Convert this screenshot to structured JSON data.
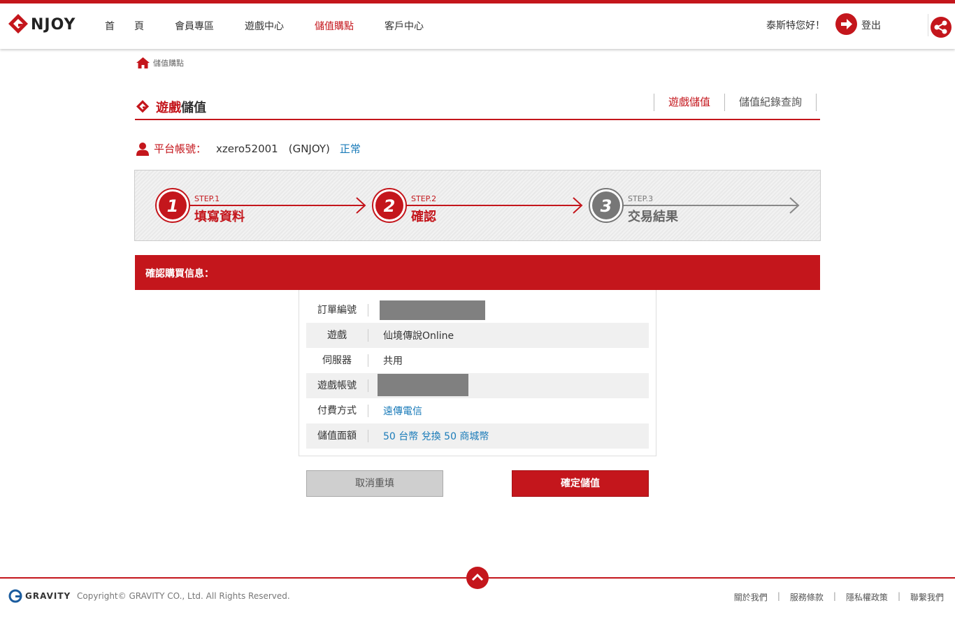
{
  "header": {
    "logo_text": "NJOY",
    "nav": [
      {
        "label": "首　　頁"
      },
      {
        "label": "會員專區"
      },
      {
        "label": "遊戲中心"
      },
      {
        "label": "儲值購點"
      },
      {
        "label": "客戶中心"
      }
    ],
    "greeting": "泰斯特您好！",
    "logout_label": "登出"
  },
  "breadcrumb": {
    "label": "儲值購點"
  },
  "page_title": {
    "part1": "遊戲",
    "part2": "儲值"
  },
  "subtabs": [
    {
      "label": "遊戲儲值"
    },
    {
      "label": "儲值紀錄查詢"
    }
  ],
  "account": {
    "label": "平台帳號：",
    "value": "xzero52001　(GNJOY)",
    "status": "正常"
  },
  "steps": [
    {
      "number": "1",
      "step": "STEP.1",
      "label": "填寫資料",
      "state": "done"
    },
    {
      "number": "2",
      "step": "STEP.2",
      "label": "確認",
      "state": "current"
    },
    {
      "number": "3",
      "step": "STEP.3",
      "label": "交易結果",
      "state": "pending"
    }
  ],
  "section_title": "確認購買信息：",
  "details": [
    {
      "key": "訂單編號",
      "value": ""
    },
    {
      "key": "遊戲",
      "value": "仙境傳說Online"
    },
    {
      "key": "伺服器",
      "value": "共用"
    },
    {
      "key": "遊戲帳號",
      "value": ""
    },
    {
      "key": "付費方式",
      "value": "遠傳電信"
    },
    {
      "key": "儲值面額",
      "value": "50 台幣 兌換 50 商城幣"
    }
  ],
  "buttons": {
    "cancel": "取消重填",
    "confirm": "確定儲值"
  },
  "footer": {
    "brand": "GRAVITY",
    "copyright": "Copyright© GRAVITY CO., Ltd. All Rights Reserved.",
    "links": [
      {
        "label": "關於我們"
      },
      {
        "label": "服務條款"
      },
      {
        "label": "隱私權政策"
      },
      {
        "label": "聯繫我們"
      }
    ]
  },
  "colors": {
    "accent": "#c4161c",
    "link": "#1a7bb9",
    "pending": "#777777"
  }
}
